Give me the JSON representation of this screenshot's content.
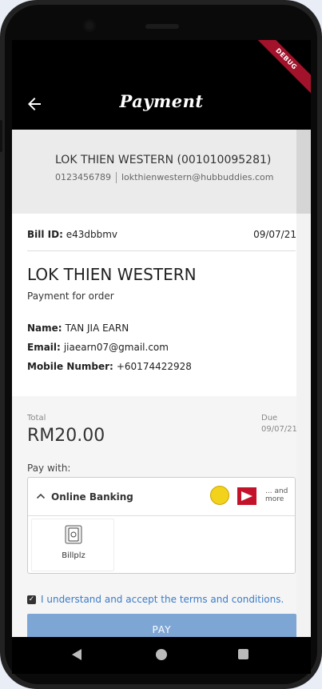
{
  "appbar": {
    "title": "Payment",
    "debug_badge": "DEBUG"
  },
  "merchant": {
    "name_line": "LOK THIEN WESTERN (001010095281)",
    "phone": "0123456789",
    "email": "lokthienwestern@hubbuddies.com"
  },
  "bill": {
    "id_label": "Bill ID:",
    "id_value": "e43dbbmv",
    "date": "09/07/21",
    "business_name": "LOK THIEN WESTERN",
    "description": "Payment for order",
    "name_label": "Name:",
    "name_value": "TAN JIA EARN",
    "email_label": "Email:",
    "email_value": "jiaearn07@gmail.com",
    "mobile_label": "Mobile Number:",
    "mobile_value": "+60174422928"
  },
  "payment": {
    "total_label": "Total",
    "total_amount": "RM20.00",
    "due_label": "Due",
    "due_date": "09/07/21",
    "pay_with_label": "Pay with:",
    "method_title": "Online Banking",
    "more_label_1": "... and",
    "more_label_2": "more",
    "option_label": "Billplz",
    "terms_text": "I understand and accept the terms and conditions.",
    "pay_button": "PAY"
  },
  "colors": {
    "accent": "#3a7bc8",
    "pay_button": "#7ea6d4",
    "debug_ribbon": "#a3122b",
    "header_bg": "#000000"
  },
  "icons": {
    "back": "arrow-left-icon",
    "chevron": "chevron-up-icon",
    "option": "banknote-icon",
    "nav_back": "triangle-back-icon",
    "nav_home": "circle-home-icon",
    "nav_recent": "square-recent-icon"
  }
}
